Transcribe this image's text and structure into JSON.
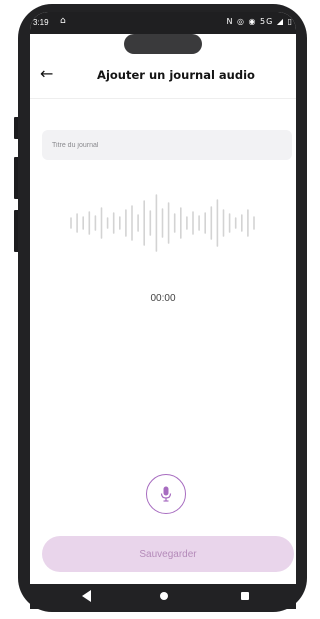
{
  "status_bar": {
    "time": "3:19",
    "home_icon": "home-icon",
    "right_icons": "N ◎ ◉ 5G ◢ ▯"
  },
  "header": {
    "back_icon": "back-arrow-icon",
    "title": "Ajouter un journal audio"
  },
  "journal_title_input": {
    "value": "",
    "placeholder": "Titre du journal"
  },
  "recording": {
    "timer": "00:00",
    "mic_icon": "microphone-icon",
    "mic_color": "#a76cc0"
  },
  "save_button": {
    "label": "Sauvegarder",
    "background": "#e9d5eb",
    "text_color": "#b48ab9",
    "state": "disabled"
  },
  "nav_bar": {
    "back": "triangle-back-icon",
    "home": "circle-home-icon",
    "recents": "square-recents-icon"
  }
}
